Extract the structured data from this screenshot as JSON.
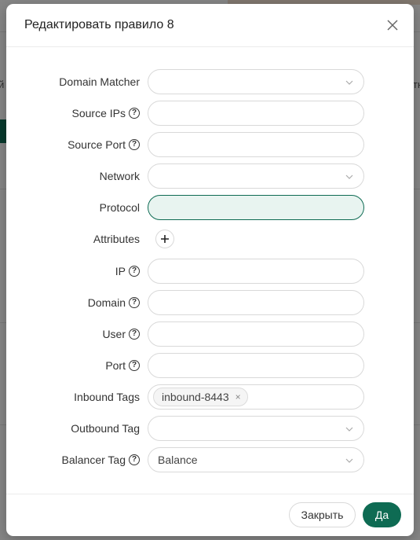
{
  "dialog": {
    "title": "Редактировать правило 8"
  },
  "form": {
    "domain_matcher": {
      "label": "Domain Matcher",
      "value": ""
    },
    "source_ips": {
      "label": "Source IPs",
      "value": ""
    },
    "source_port": {
      "label": "Source Port",
      "value": ""
    },
    "network": {
      "label": "Network",
      "value": ""
    },
    "protocol": {
      "label": "Protocol",
      "value": ""
    },
    "attributes": {
      "label": "Attributes"
    },
    "ip": {
      "label": "IP",
      "value": ""
    },
    "domain": {
      "label": "Domain",
      "value": ""
    },
    "user": {
      "label": "User",
      "value": ""
    },
    "port": {
      "label": "Port",
      "value": ""
    },
    "inbound_tags": {
      "label": "Inbound Tags",
      "tags": [
        "inbound-8443"
      ],
      "remove_glyph": "×"
    },
    "outbound_tag": {
      "label": "Outbound Tag",
      "value": ""
    },
    "balancer_tag": {
      "label": "Balancer Tag",
      "value": "Balance"
    }
  },
  "footer": {
    "cancel_label": "Закрыть",
    "ok_label": "Да"
  },
  "icons": {
    "help": "?",
    "close": "close-icon",
    "chevron": "chevron-down-icon",
    "plus": "plus-icon"
  },
  "background": {
    "left_text": "й",
    "right_text": "тн"
  },
  "colors": {
    "primary": "#0e6b53",
    "focused_bg": "#e8f4f0"
  }
}
